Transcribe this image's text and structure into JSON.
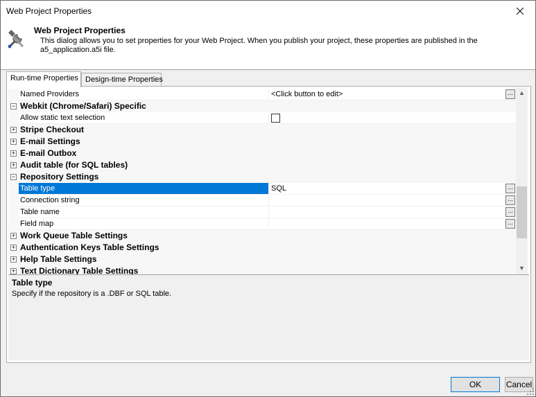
{
  "window": {
    "title": "Web Project Properties"
  },
  "header": {
    "title": "Web Project Properties",
    "description": "This dialog allows you to set properties for your Web Project. When you publish your project, these properties are published in the a5_application.a5i file."
  },
  "tabs": [
    {
      "label": "Run-time Properties",
      "active": true
    },
    {
      "label": "Design-time Properties",
      "active": false
    }
  ],
  "grid": {
    "rows": [
      {
        "kind": "prop",
        "name": "Named Providers",
        "value": "<Click button to edit>",
        "button": true
      },
      {
        "kind": "cat",
        "name": "Webkit (Chrome/Safari) Specific",
        "expanded": true
      },
      {
        "kind": "prop",
        "name": "Allow static text selection",
        "value": "",
        "checkbox": true
      },
      {
        "kind": "cat",
        "name": "Stripe Checkout",
        "expanded": false
      },
      {
        "kind": "cat",
        "name": "E-mail Settings",
        "expanded": false
      },
      {
        "kind": "cat",
        "name": "E-mail Outbox",
        "expanded": false
      },
      {
        "kind": "cat",
        "name": "Audit table (for SQL tables)",
        "expanded": false
      },
      {
        "kind": "cat",
        "name": "Repository Settings",
        "expanded": true
      },
      {
        "kind": "prop",
        "name": "Table type",
        "value": "SQL",
        "button": true,
        "selected": true
      },
      {
        "kind": "prop",
        "name": "Connection string",
        "value": "",
        "button": true
      },
      {
        "kind": "prop",
        "name": "Table name",
        "value": "",
        "button": true
      },
      {
        "kind": "prop",
        "name": "Field map",
        "value": "",
        "button": true
      },
      {
        "kind": "cat",
        "name": "Work Queue Table Settings",
        "expanded": false
      },
      {
        "kind": "cat",
        "name": "Authentication Keys Table Settings",
        "expanded": false
      },
      {
        "kind": "cat",
        "name": "Help Table Settings",
        "expanded": false
      },
      {
        "kind": "cat",
        "name": "Text Dictionary Table Settings",
        "expanded": false
      }
    ],
    "ellipsis_label": "..."
  },
  "description_pane": {
    "title": "Table type",
    "text": "Specify if the repository is a .DBF or SQL table."
  },
  "buttons": {
    "ok": "OK",
    "cancel": "Cancel"
  },
  "colors": {
    "selection": "#0078d7",
    "category_bg": "#f7f7f7",
    "dialog_bg": "#f0f0f0"
  }
}
